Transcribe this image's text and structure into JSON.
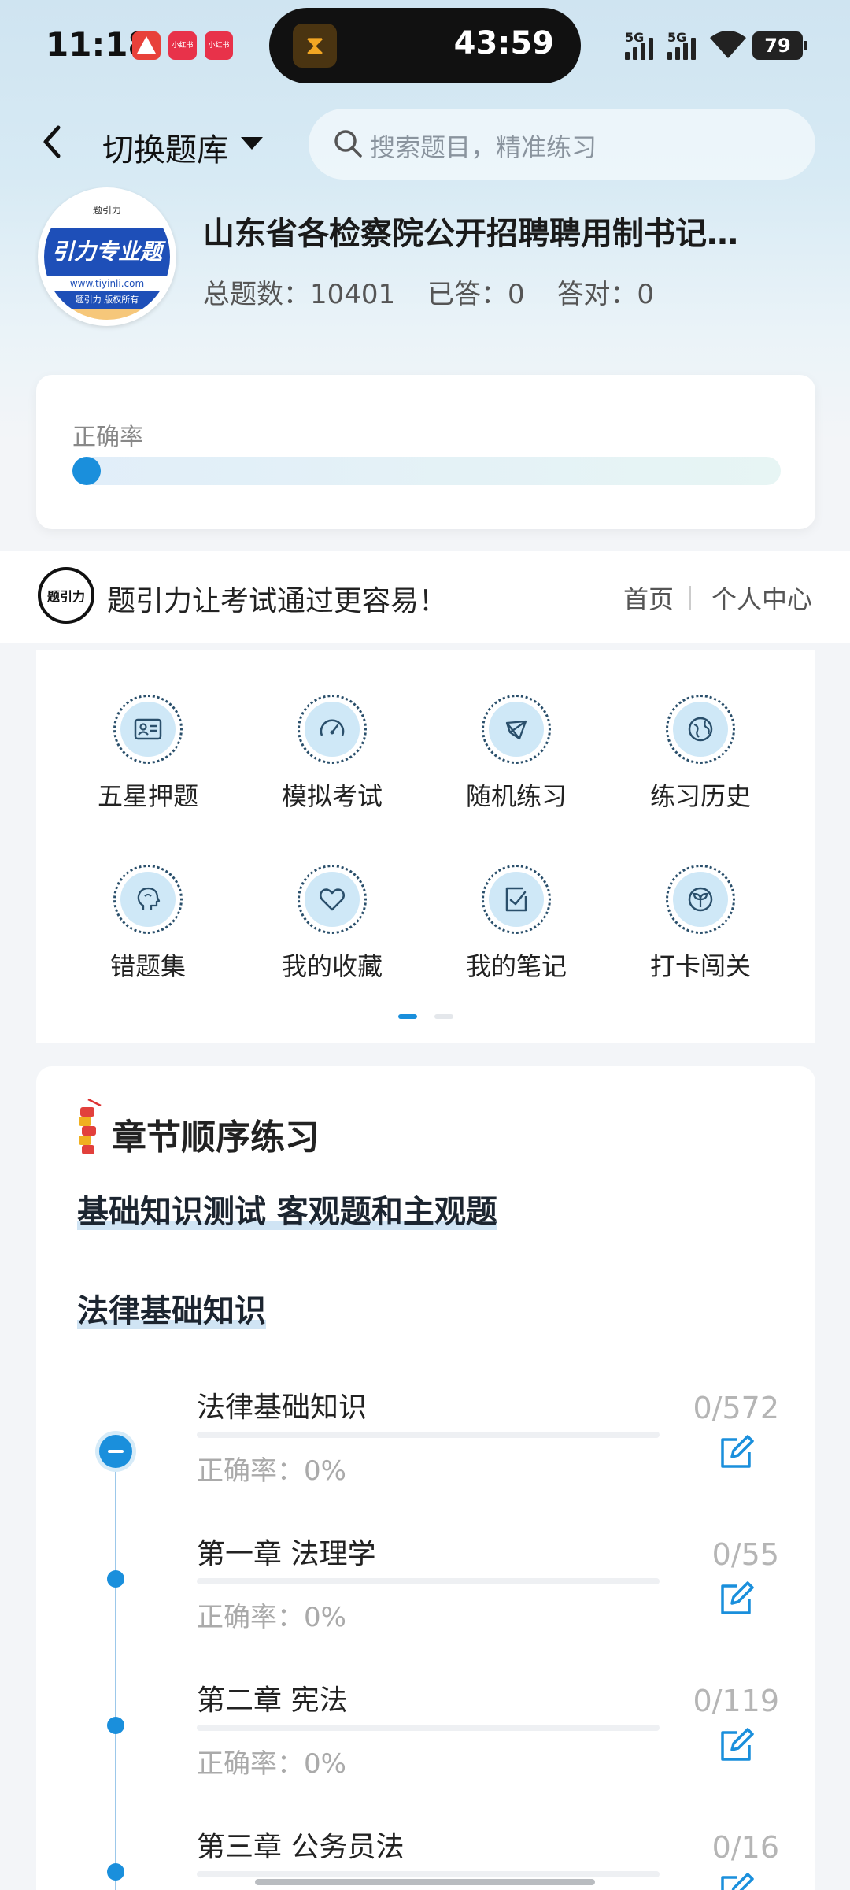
{
  "status_bar": {
    "time": "11:18",
    "apps": [
      "小红书",
      "小红书"
    ],
    "timer": "43:59",
    "signal_1": "5G",
    "signal_2": "5G",
    "battery": "79"
  },
  "header": {
    "switch_label": "切换题库",
    "search_placeholder": "搜索题目，精准练习"
  },
  "bank": {
    "logo_text": "引力专业题",
    "logo_url": "www.tiyinli.com",
    "logo_copyright": "题引力 版权所有",
    "logo_top": "题引力",
    "title": "山东省各检察院公开招聘聘用制书记…",
    "total": "总题数：10401",
    "answered": "已答：0",
    "correct": "答对：0"
  },
  "accuracy": {
    "label": "正确率",
    "value": 0
  },
  "banner": {
    "logo_text": "题引力",
    "slogan": "题引力让考试通过更容易！",
    "home": "首页",
    "personal": "个人中心"
  },
  "functions": [
    {
      "label": "五星押题",
      "icon": "id-card-icon"
    },
    {
      "label": "模拟考试",
      "icon": "speedometer-icon"
    },
    {
      "label": "随机练习",
      "icon": "shuffle-node-icon"
    },
    {
      "label": "练习历史",
      "icon": "globe-icon"
    },
    {
      "label": "错题集",
      "icon": "head-icon"
    },
    {
      "label": "我的收藏",
      "icon": "heart-icon"
    },
    {
      "label": "我的笔记",
      "icon": "note-check-icon"
    },
    {
      "label": "打卡闯关",
      "icon": "leaf-icon"
    }
  ],
  "chapters": {
    "title": "章节顺序练习",
    "section1": "基础知识测试 客观题和主观题",
    "section2": "法律基础知识",
    "items": [
      {
        "name": "法律基础知识",
        "accuracy": "正确率：0%",
        "count": "0/572"
      },
      {
        "name": "第一章 法理学",
        "accuracy": "正确率：0%",
        "count": "0/55"
      },
      {
        "name": "第二章 宪法",
        "accuracy": "正确率：0%",
        "count": "0/119"
      },
      {
        "name": "第三章 公务员法",
        "accuracy": "",
        "count": "0/16"
      }
    ]
  },
  "colors": {
    "accent": "#1a8fdc",
    "logo_blue": "#1e4fb8"
  }
}
